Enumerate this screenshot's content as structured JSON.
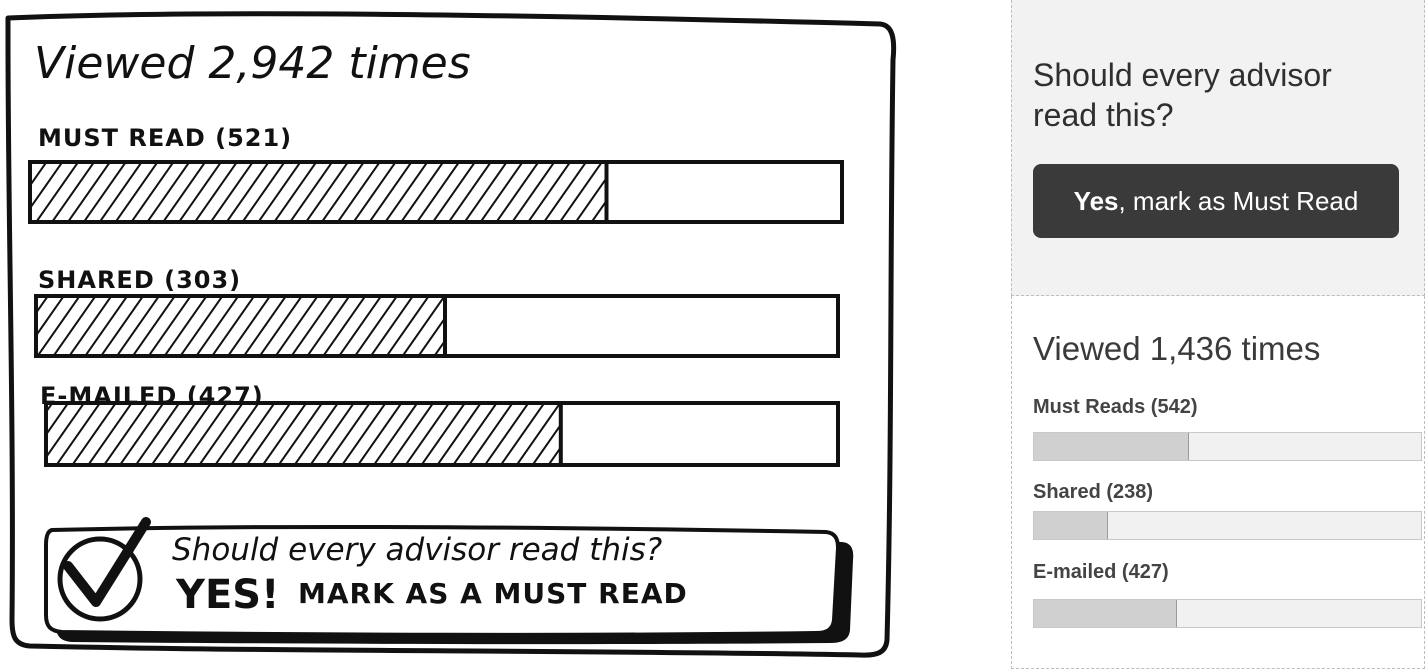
{
  "sketch": {
    "title": "Viewed 2,942 times",
    "bars": [
      {
        "label": "MUST READ (521)",
        "fill": 0.71
      },
      {
        "label": "SHARED (303)",
        "fill": 0.51
      },
      {
        "label": "E-MAILED (427)",
        "fill": 0.65
      }
    ],
    "cta": {
      "question": "Should every advisor read this?",
      "yes": "YES!",
      "action": "MARK AS A MUST READ",
      "icon": "checkmark-circle-icon"
    }
  },
  "mockup": {
    "prompt": {
      "question": "Should every advisor read this?",
      "button_bold": "Yes",
      "button_rest": ", mark as Must Read"
    },
    "stats": {
      "title": "Viewed 1,436 times",
      "items": [
        {
          "label": "Must Reads (542)",
          "fill": 0.4
        },
        {
          "label": "Shared (238)",
          "fill": 0.19
        },
        {
          "label": "E-mailed (427)",
          "fill": 0.37
        }
      ]
    },
    "colors": {
      "button_bg": "#3a3a3a",
      "panel_bg": "#f2f2f2",
      "bar_fill": "#d0d0d0"
    }
  }
}
